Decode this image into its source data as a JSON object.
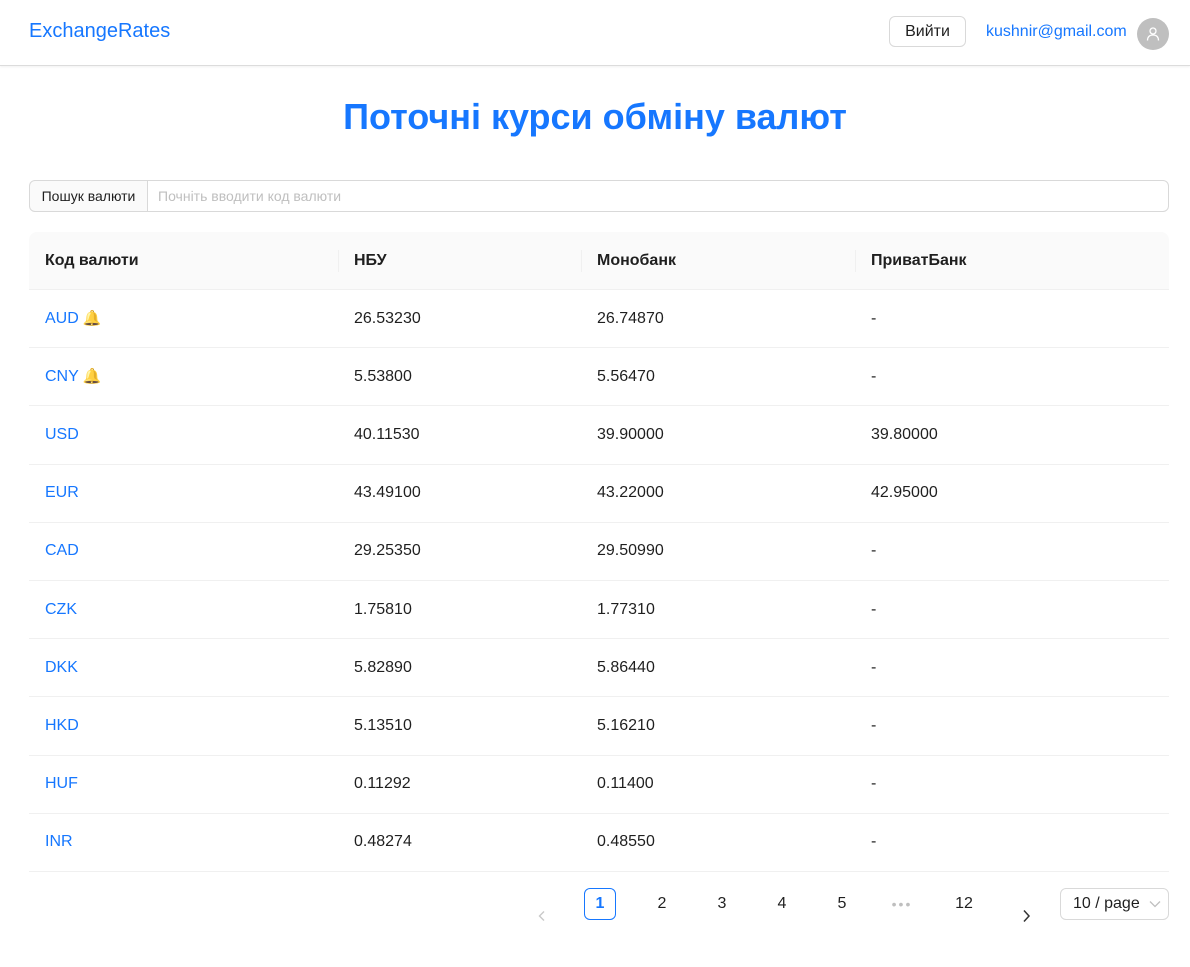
{
  "header": {
    "brand": "ExchangeRates",
    "logout_label": "Вийти",
    "user_email": "kushnir@gmail.com"
  },
  "main": {
    "title": "Поточні курси обміну валют",
    "search": {
      "addon_label": "Пошук валюти",
      "placeholder": "Почніть вводити код валюти",
      "value": ""
    },
    "table": {
      "columns": [
        "Код валюти",
        "НБУ",
        "Монобанк",
        "ПриватБанк"
      ],
      "rows": [
        {
          "code": "AUD",
          "bell": "🔔",
          "nbu": "26.53230",
          "mono": "26.74870",
          "privat": "-"
        },
        {
          "code": "CNY",
          "bell": "🔔",
          "nbu": "5.53800",
          "mono": "5.56470",
          "privat": "-"
        },
        {
          "code": "USD",
          "bell": "",
          "nbu": "40.11530",
          "mono": "39.90000",
          "privat": "39.80000"
        },
        {
          "code": "EUR",
          "bell": "",
          "nbu": "43.49100",
          "mono": "43.22000",
          "privat": "42.95000"
        },
        {
          "code": "CAD",
          "bell": "",
          "nbu": "29.25350",
          "mono": "29.50990",
          "privat": "-"
        },
        {
          "code": "CZK",
          "bell": "",
          "nbu": "1.75810",
          "mono": "1.77310",
          "privat": "-"
        },
        {
          "code": "DKK",
          "bell": "",
          "nbu": "5.82890",
          "mono": "5.86440",
          "privat": "-"
        },
        {
          "code": "HKD",
          "bell": "",
          "nbu": "5.13510",
          "mono": "5.16210",
          "privat": "-"
        },
        {
          "code": "HUF",
          "bell": "",
          "nbu": "0.11292",
          "mono": "0.11400",
          "privat": "-"
        },
        {
          "code": "INR",
          "bell": "",
          "nbu": "0.48274",
          "mono": "0.48550",
          "privat": "-"
        }
      ]
    },
    "pagination": {
      "pages": [
        "1",
        "2",
        "3",
        "4",
        "5",
        "12"
      ],
      "current": "1",
      "ellipsis": "•••",
      "page_size": "10 / page"
    }
  },
  "colors": {
    "accent": "#1677ff",
    "border": "#d9d9d9",
    "header_bg": "#fafafa"
  },
  "icons": {
    "avatar": "user-icon",
    "alert": "bell-icon",
    "prev": "chevron-left-icon",
    "next": "chevron-right-icon",
    "page_size": "chevron-down-icon"
  }
}
